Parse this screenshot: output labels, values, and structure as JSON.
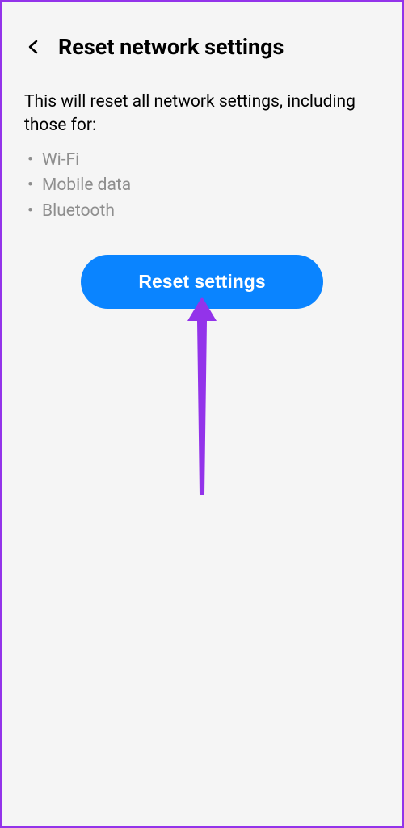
{
  "header": {
    "title": "Reset network settings"
  },
  "description": "This will reset all network settings, including those for:",
  "items": {
    "0": "Wi-Fi",
    "1": "Mobile data",
    "2": "Bluetooth"
  },
  "button": {
    "label": "Reset settings"
  },
  "colors": {
    "accent": "#0a84ff",
    "annotation": "#9333ea"
  }
}
